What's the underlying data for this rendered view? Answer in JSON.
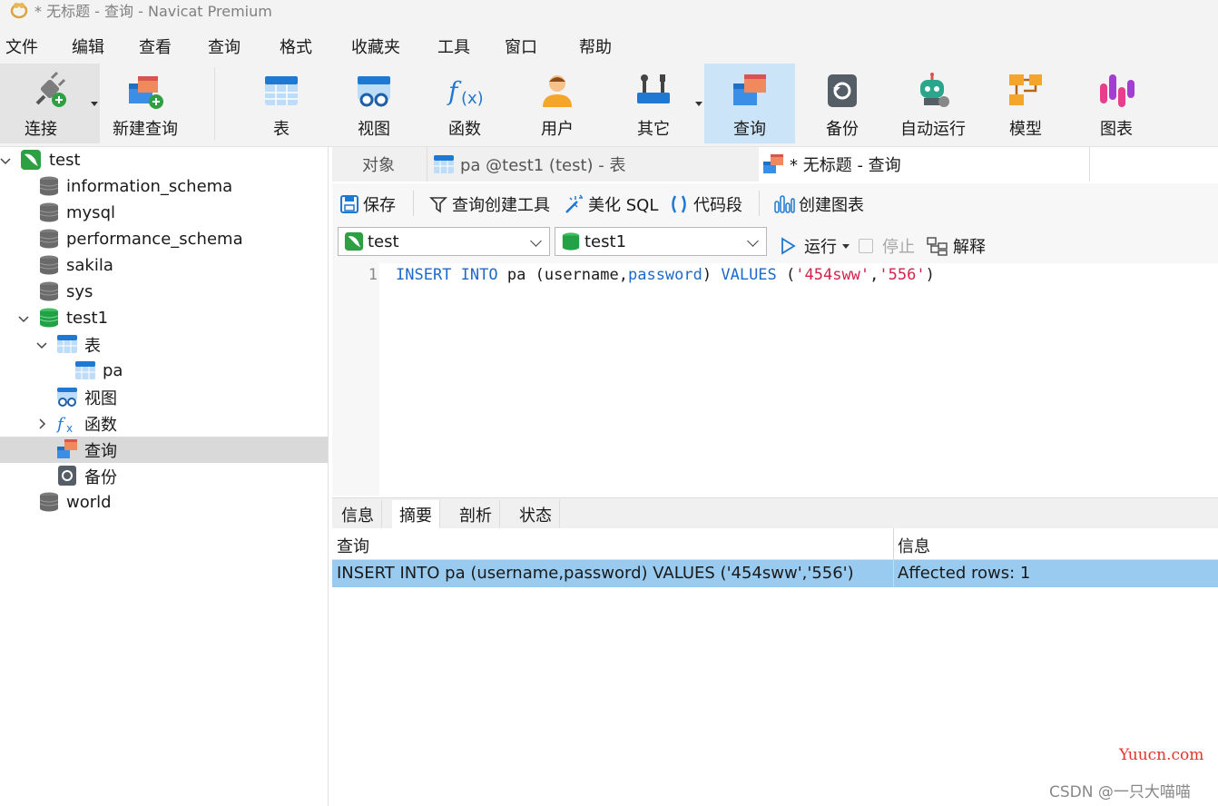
{
  "window": {
    "title": "* 无标题 - 查询 - Navicat Premium"
  },
  "menu": {
    "items": [
      "文件",
      "编辑",
      "查看",
      "查询",
      "格式",
      "收藏夹",
      "工具",
      "窗口",
      "帮助"
    ]
  },
  "toolbar": {
    "connect": "连接",
    "new_query": "新建查询",
    "table": "表",
    "view": "视图",
    "function": "函数",
    "user": "用户",
    "other": "其它",
    "query": "查询",
    "backup": "备份",
    "automation": "自动运行",
    "model": "模型",
    "chart": "图表"
  },
  "sidebar": {
    "connection": "test",
    "databases": [
      "information_schema",
      "mysql",
      "performance_schema",
      "sakila",
      "sys"
    ],
    "open_db": "test1",
    "nodes": {
      "tables": "表",
      "table_pa": "pa",
      "views": "视图",
      "functions": "函数",
      "queries": "查询",
      "backups": "备份"
    },
    "last_db": "world"
  },
  "tabs": {
    "objects": "对象",
    "table_tab": "pa @test1 (test) - 表",
    "query_tab": "* 无标题 - 查询"
  },
  "query_toolbar": {
    "save": "保存",
    "builder": "查询创建工具",
    "beautify": "美化 SQL",
    "snippet": "代码段",
    "create_chart": "创建图表"
  },
  "selectors": {
    "connection": "test",
    "database": "test1",
    "run": "运行",
    "stop": "停止",
    "explain": "解释"
  },
  "editor": {
    "line_number": "1",
    "kw_insert": "INSERT",
    "kw_into": "INTO",
    "table": "pa",
    "col_username": "username",
    "col_password": "password",
    "kw_values": "VALUES",
    "val1": "'454sww'",
    "val2": "'556'"
  },
  "result_tabs": [
    "信息",
    "摘要",
    "剖析",
    "状态"
  ],
  "result": {
    "headers": [
      "查询",
      "信息"
    ],
    "row": [
      "INSERT INTO pa (username,password) VALUES ('454sww','556')",
      "Affected rows: 1"
    ]
  },
  "watermarks": {
    "site": "Yuucn.com",
    "csdn": "CSDN @一只大喵喵"
  },
  "colors": {
    "selection": "#99cbf0",
    "keyword": "#1c6ac9",
    "string": "#d4224a",
    "active_toolbar": "#cce4f7"
  }
}
